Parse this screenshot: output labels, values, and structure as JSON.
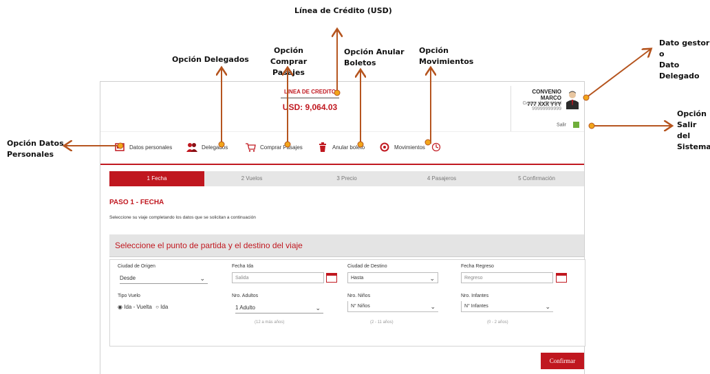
{
  "callouts": {
    "credit_line": "Línea de Crédito (USD)",
    "delegates": "Opción Delegados",
    "buy_tickets": "Opción Comprar\nPasajes",
    "cancel_tickets": "Opción Anular\nBoletos",
    "movements": "Opción\nMovimientos",
    "manager": "Dato gestor\no\nDato\nDelegado",
    "logout": "Opción\nSalir del\nSistema",
    "personal_data": "Opción Datos\nPersonales"
  },
  "header": {
    "credit_label": "LINEA DE CREDITO",
    "credit_value": "USD: 9,064.03",
    "user_name": "CONVENIO MARCO",
    "user_id": "777 XXX YYY",
    "user_role": "Gestor de Entidad",
    "user_code": "99999999999",
    "logout_label": "Salir"
  },
  "nav": {
    "personal": "Datos personales",
    "delegates": "Delegados",
    "buy": "Comprar Pasajes",
    "cancel": "Anular boleto",
    "movements": "Movimientos"
  },
  "steps": [
    "1 Fecha",
    "2 Vuelos",
    "3 Precio",
    "4 Pasajeros",
    "5 Confirmación"
  ],
  "page": {
    "title": "PASO 1 - FECHA",
    "description": "Seleccione su viaje completando los datos que se solicitan a continuación",
    "section_title": "Seleccione el punto de partida y el destino del viaje"
  },
  "form": {
    "origin_label": "Ciudad de Origen",
    "origin_value": "Desde",
    "date_out_label": "Fecha Ida",
    "date_out_placeholder": "Salida",
    "dest_label": "Ciudad de Destino",
    "dest_value": "Hasta",
    "date_back_label": "Fecha Regreso",
    "date_back_placeholder": "Regreso",
    "flight_type_label": "Tipo Vuelo",
    "roundtrip_label": "Ida - Vuelta",
    "oneway_label": "Ida",
    "adults_label": "Nro. Adultos",
    "adults_value": "1 Adulto",
    "adults_hint": "(12 a más años)",
    "children_label": "Nro. Niños",
    "children_value": "N° Niños",
    "children_hint": "(2 - 11 años)",
    "infants_label": "Nro. Infantes",
    "infants_value": "N° Infantes",
    "infants_hint": "(0 - 2 años)"
  },
  "actions": {
    "confirm": "Confirmar"
  },
  "colors": {
    "accent": "#c0171f",
    "callout_arrow": "#b5541e",
    "callout_dot": "#f2a51a"
  }
}
